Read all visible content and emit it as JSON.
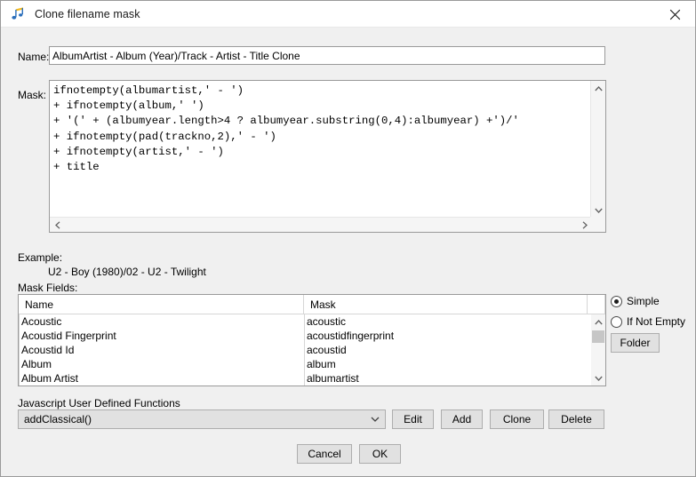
{
  "window": {
    "title": "Clone filename mask",
    "icon": "music-note-icon",
    "close_label": "✕",
    "background_color": "#f0f0f0",
    "titlebar_color": "#ffffff"
  },
  "name_field": {
    "label": "Name:",
    "value": "AlbumArtist - Album (Year)/Track - Artist - Title Clone"
  },
  "mask_field": {
    "label": "Mask:",
    "lines": [
      "ifnotempty(albumartist,' - ')",
      "+ ifnotempty(album,' ')",
      "+ '(' + (albumyear.length>4 ? albumyear.substring(0,4):albumyear) +')/'",
      "+ ifnotempty(pad(trackno,2),' - ')",
      "+ ifnotempty(artist,' - ')",
      "+ title"
    ],
    "text": "ifnotempty(albumartist,' - ')\n+ ifnotempty(album,' ')\n+ '(' + (albumyear.length>4 ? albumyear.substring(0,4):albumyear) +')/'\n+ ifnotempty(pad(trackno,2),' - ')\n+ ifnotempty(artist,' - ')\n+ title"
  },
  "example": {
    "label": "Example:",
    "value": "U2 - Boy (1980)/02 - U2 - Twilight"
  },
  "mask_fields": {
    "label": "Mask Fields:",
    "columns": [
      "Name",
      "Mask"
    ],
    "rows": [
      {
        "name": "Acoustic",
        "mask": "acoustic"
      },
      {
        "name": "Acoustid Fingerprint",
        "mask": "acoustidfingerprint"
      },
      {
        "name": "Acoustid Id",
        "mask": "acoustid"
      },
      {
        "name": "Album",
        "mask": "album"
      },
      {
        "name": "Album Artist",
        "mask": "albumartist"
      }
    ]
  },
  "options": {
    "simple_label": "Simple",
    "if_not_empty_label": "If Not Empty",
    "selected": "Simple",
    "folder_button": "Folder"
  },
  "udf": {
    "label": "Javascript User Defined Functions",
    "selected": "addClassical()",
    "edit_label": "Edit",
    "add_label": "Add",
    "clone_label": "Clone",
    "delete_label": "Delete"
  },
  "footer": {
    "cancel_label": "Cancel",
    "ok_label": "OK"
  }
}
